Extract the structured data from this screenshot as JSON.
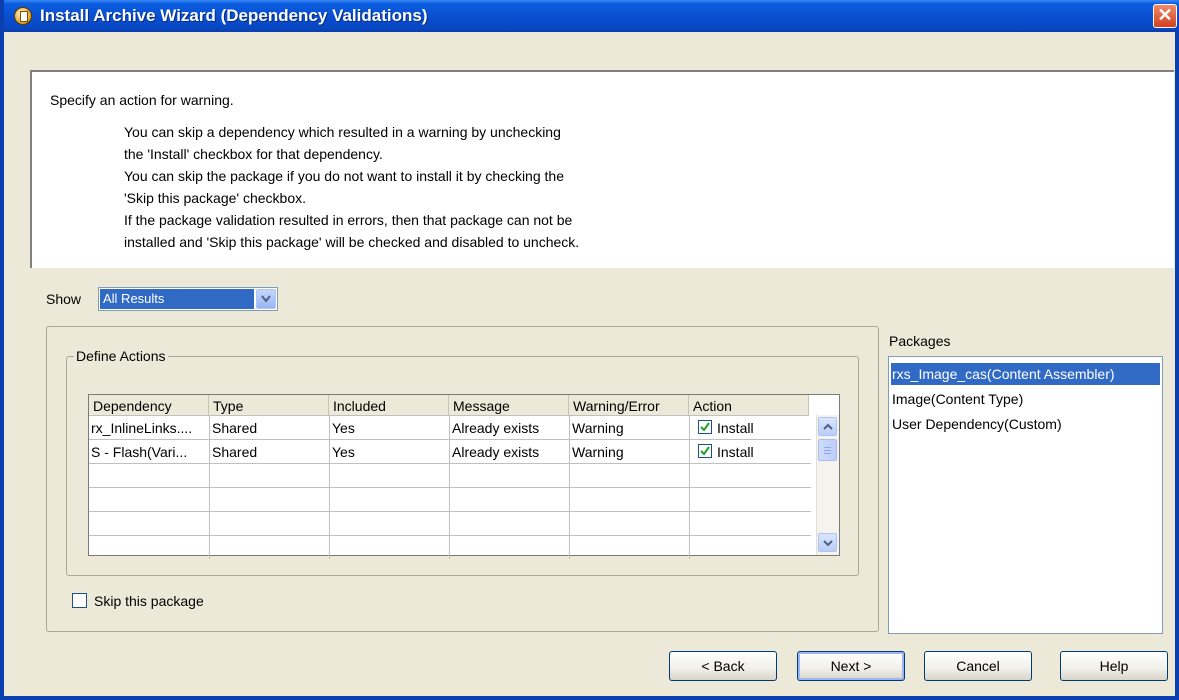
{
  "window": {
    "title": "Install Archive Wizard (Dependency Validations)",
    "close_glyph": "✕"
  },
  "instructions": {
    "lead": "Specify an action for warning.",
    "lines": [
      "You can skip a dependency which resulted in a warning by unchecking",
      "the 'Install' checkbox for that dependency.",
      "You can skip the package if you do not want to install it by checking the",
      "'Skip this package' checkbox.",
      "If the package validation resulted in errors, then that package can not be",
      "installed and 'Skip this package' will be checked and disabled to uncheck."
    ]
  },
  "show": {
    "label": "Show",
    "selected": "All Results"
  },
  "define_actions": {
    "label": "Define Actions",
    "columns": [
      "Dependency",
      "Type",
      "Included",
      "Message",
      "Warning/Error",
      "Action"
    ],
    "rows": [
      {
        "dependency": "rx_InlineLinks....",
        "type": "Shared",
        "included": "Yes",
        "message": "Already exists",
        "warning": "Warning",
        "action": "Install",
        "checked": true
      },
      {
        "dependency": "S - Flash(Vari...",
        "type": "Shared",
        "included": "Yes",
        "message": "Already exists",
        "warning": "Warning",
        "action": "Install",
        "checked": true
      }
    ]
  },
  "skip_package": {
    "label": "Skip this package",
    "checked": false
  },
  "packages": {
    "label": "Packages",
    "items": [
      "rxs_Image_cas(Content Assembler)",
      "Image(Content Type)",
      "User Dependency(Custom)"
    ],
    "selected_index": 0
  },
  "buttons": {
    "back": "< Back",
    "next": "Next >",
    "cancel": "Cancel",
    "help": "Help"
  },
  "colors": {
    "title_bar": "#0a4fd0",
    "selection": "#316ac5",
    "dialog_bg": "#ece9d8",
    "check": "#21a121"
  },
  "icons": {
    "window": "archive-app-icon",
    "close": "close-icon",
    "dropdown": "chevron-down-icon"
  }
}
